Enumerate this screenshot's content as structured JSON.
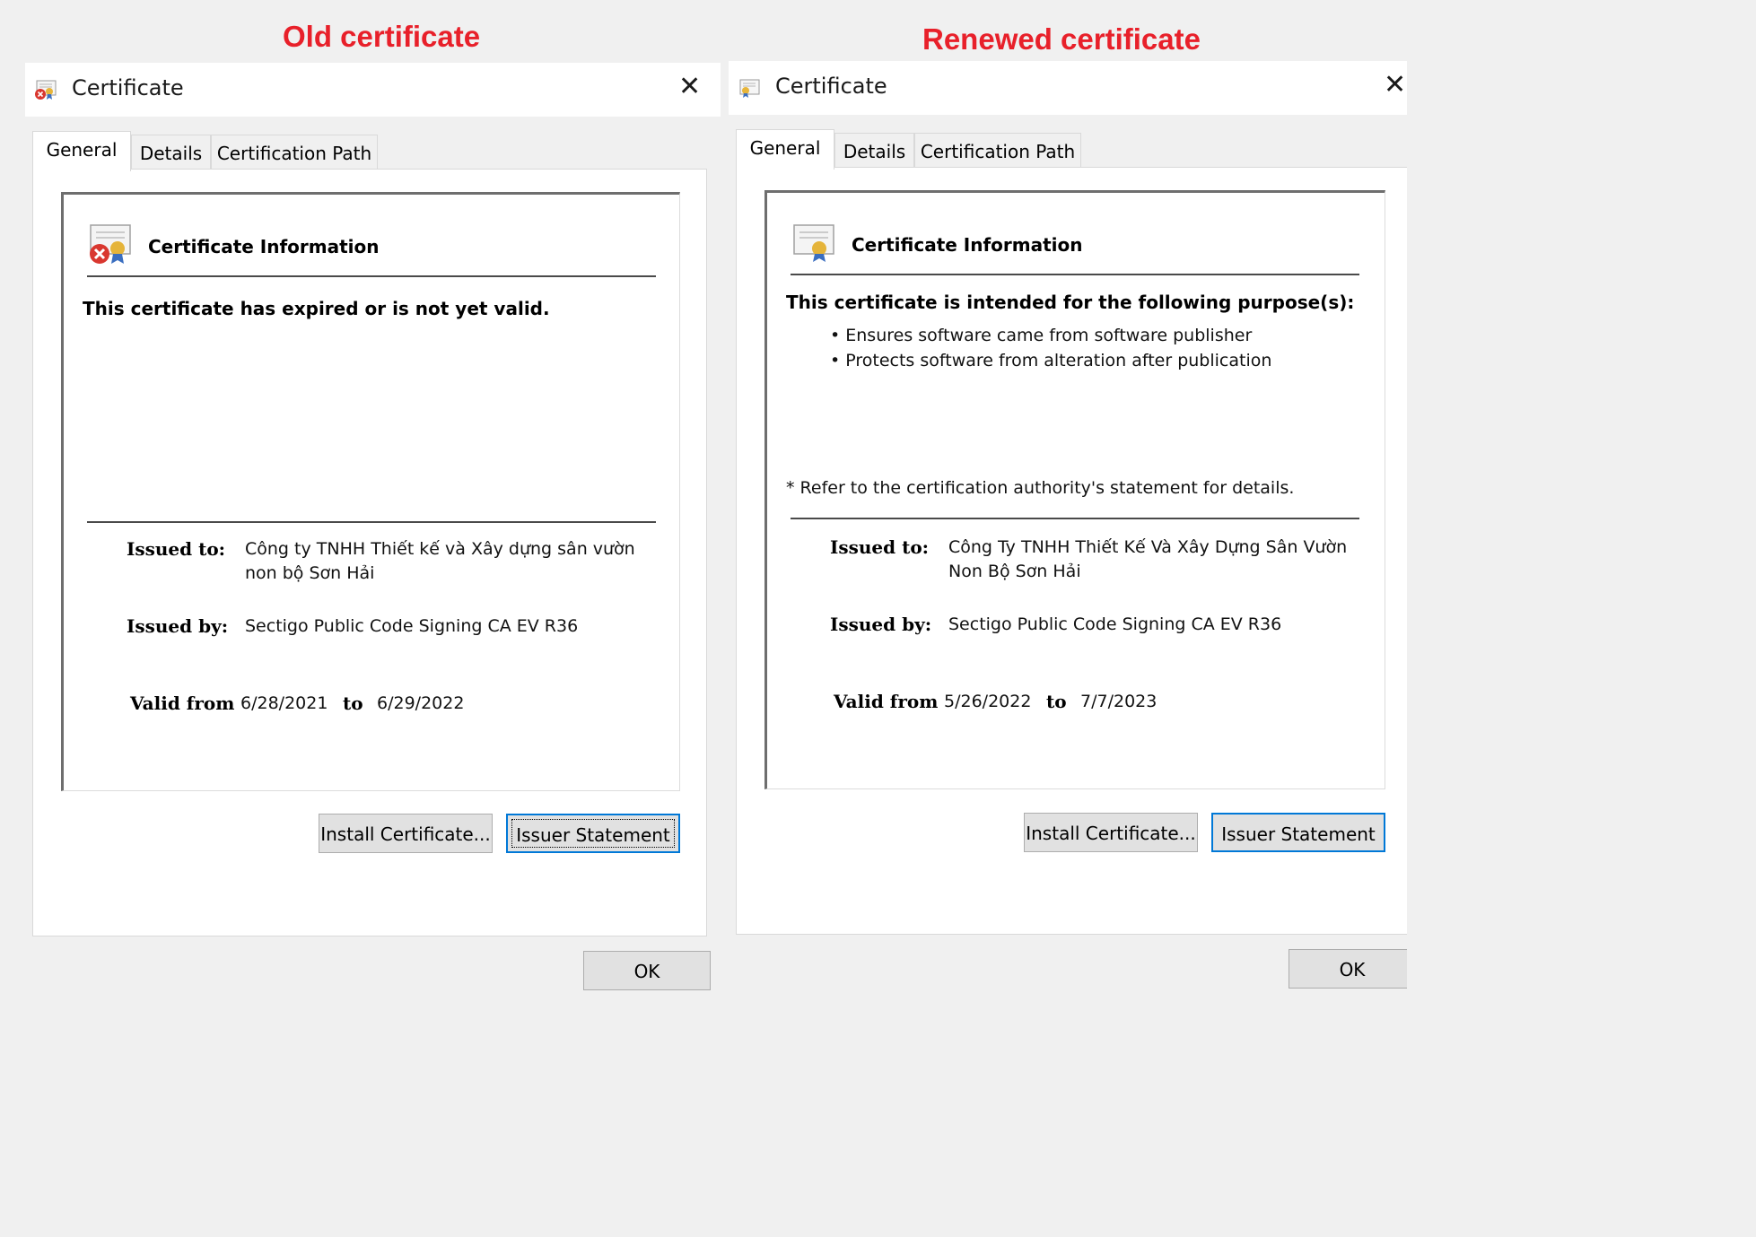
{
  "captions": {
    "old": "Old certificate",
    "renewed": "Renewed certificate"
  },
  "dialogs": {
    "old": {
      "title": "Certificate",
      "close_symbol": "✕",
      "tabs": [
        "General",
        "Details",
        "Certification Path"
      ],
      "heading": "Certificate Information",
      "status": "This certificate has expired or is not yet valid.",
      "issued_to_label": "Issued to:",
      "issued_to": "Công ty TNHH Thiết kế và Xây dựng sân vườn non bộ Sơn Hải",
      "issued_by_label": "Issued by:",
      "issued_by": "Sectigo Public Code Signing CA EV R36",
      "valid_from_label": "Valid from",
      "valid_from": "6/28/2021",
      "to_label": "to",
      "valid_to": "6/29/2022",
      "install_button": "Install Certificate...",
      "issuer_button": "Issuer Statement",
      "ok_button": "OK",
      "icon": "certificate-error-icon"
    },
    "renewed": {
      "title": "Certificate",
      "close_symbol": "✕",
      "tabs": [
        "General",
        "Details",
        "Certification Path"
      ],
      "heading": "Certificate Information",
      "purpose_heading": "This certificate is intended for the following purpose(s):",
      "purposes": [
        "• Ensures software came from software publisher",
        "• Protects software from alteration after publication"
      ],
      "note": "* Refer to the certification authority's statement for details.",
      "issued_to_label": "Issued to:",
      "issued_to": "Công Ty TNHH Thiết Kế Và Xây Dựng Sân Vườn Non Bộ Sơn Hải",
      "issued_by_label": "Issued by:",
      "issued_by": "Sectigo Public Code Signing CA EV R36",
      "valid_from_label": "Valid from",
      "valid_from": "5/26/2022",
      "to_label": "to",
      "valid_to": "7/7/2023",
      "install_button": "Install Certificate...",
      "issuer_button": "Issuer Statement",
      "ok_button": "OK",
      "icon": "certificate-icon"
    }
  },
  "colors": {
    "caption": "#e8202a",
    "focus": "#0078d7"
  }
}
